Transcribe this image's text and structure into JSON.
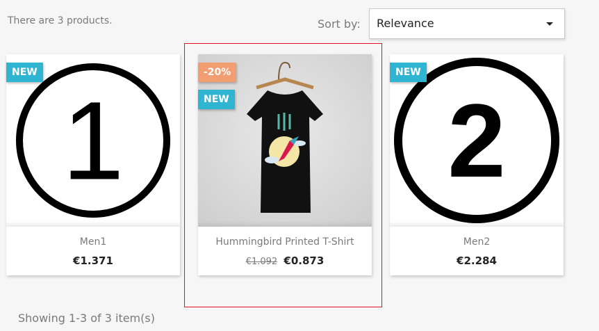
{
  "listing": {
    "count_text": "There are 3 products.",
    "showing_text": "Showing 1-3 of 3 item(s)"
  },
  "sort": {
    "label": "Sort by:",
    "value": "Relevance"
  },
  "products": [
    {
      "title": "Men1",
      "price": "€1.371",
      "flags": [
        "NEW"
      ],
      "image": "number-one-circle-icon",
      "image_text": "1"
    },
    {
      "title": "Hummingbird Printed T-Shirt",
      "old_price": "€1.092",
      "price": "€0.873",
      "flags": [
        "-20%",
        "NEW"
      ],
      "image": "tshirt-photo"
    },
    {
      "title": "Men2",
      "price": "€2.284",
      "flags": [
        "NEW"
      ],
      "image": "number-two-circle-icon",
      "image_text": "2"
    }
  ],
  "colors": {
    "accent_new": "#2fb5d2",
    "accent_discount": "#f39d72",
    "highlight": "#e0131b"
  }
}
